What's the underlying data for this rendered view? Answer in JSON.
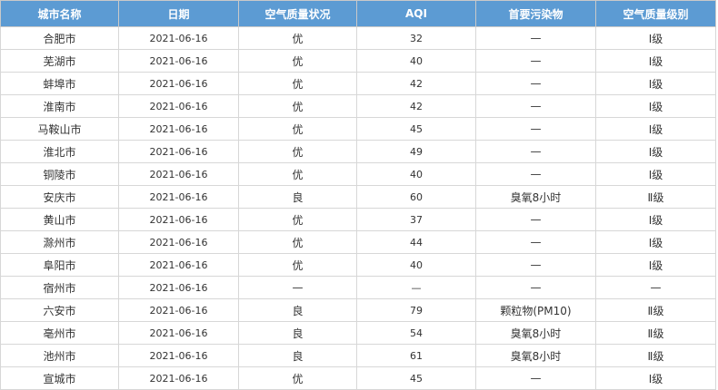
{
  "table": {
    "headers": [
      "城市名称",
      "日期",
      "空气质量状况",
      "AQI",
      "首要污染物",
      "空气质量级别"
    ],
    "rows": [
      [
        "合肥市",
        "2021-06-16",
        "优",
        "32",
        "—",
        "Ⅰ级"
      ],
      [
        "芜湖市",
        "2021-06-16",
        "优",
        "40",
        "—",
        "Ⅰ级"
      ],
      [
        "蚌埠市",
        "2021-06-16",
        "优",
        "42",
        "—",
        "Ⅰ级"
      ],
      [
        "淮南市",
        "2021-06-16",
        "优",
        "42",
        "—",
        "Ⅰ级"
      ],
      [
        "马鞍山市",
        "2021-06-16",
        "优",
        "45",
        "—",
        "Ⅰ级"
      ],
      [
        "淮北市",
        "2021-06-16",
        "优",
        "49",
        "—",
        "Ⅰ级"
      ],
      [
        "铜陵市",
        "2021-06-16",
        "优",
        "40",
        "—",
        "Ⅰ级"
      ],
      [
        "安庆市",
        "2021-06-16",
        "良",
        "60",
        "臭氧8小时",
        "Ⅱ级"
      ],
      [
        "黄山市",
        "2021-06-16",
        "优",
        "37",
        "—",
        "Ⅰ级"
      ],
      [
        "滁州市",
        "2021-06-16",
        "优",
        "44",
        "—",
        "Ⅰ级"
      ],
      [
        "阜阳市",
        "2021-06-16",
        "优",
        "40",
        "—",
        "Ⅰ级"
      ],
      [
        "宿州市",
        "2021-06-16",
        "—",
        "—",
        "—",
        "—"
      ],
      [
        "六安市",
        "2021-06-16",
        "良",
        "79",
        "颗粒物(PM10)",
        "Ⅱ级"
      ],
      [
        "亳州市",
        "2021-06-16",
        "良",
        "54",
        "臭氧8小时",
        "Ⅱ级"
      ],
      [
        "池州市",
        "2021-06-16",
        "良",
        "61",
        "臭氧8小时",
        "Ⅱ级"
      ],
      [
        "宣城市",
        "2021-06-16",
        "优",
        "45",
        "—",
        "Ⅰ级"
      ]
    ]
  },
  "colors": {
    "header_background": "#5c9bd3",
    "header_text": "#ffffff",
    "border": "#d7d7d7"
  }
}
